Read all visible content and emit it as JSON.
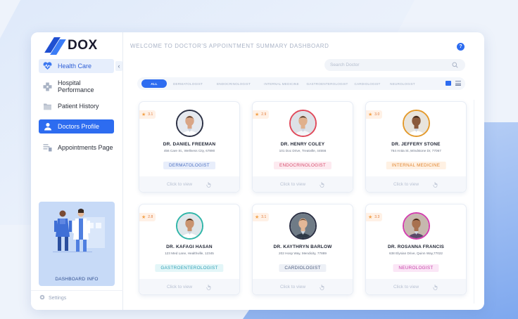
{
  "app": {
    "logo": "DOX"
  },
  "sidebar": {
    "items": [
      {
        "label": "Health Care",
        "icon": "heart-pulse-icon"
      },
      {
        "label": "Hospital Performance",
        "icon": "hospital-icon"
      },
      {
        "label": "Patient History",
        "icon": "folder-icon"
      },
      {
        "label": "Doctors Profile",
        "icon": "user-icon"
      },
      {
        "label": "Appointments Page",
        "icon": "calendar-list-icon"
      }
    ],
    "promo_label": "DASHBOARD INFO",
    "settings_label": "Settings"
  },
  "header": {
    "title": "WELCOME TO DOCTOR'S APPOINTMENT SUMMARY DASHBOARD",
    "help": "?"
  },
  "search": {
    "placeholder": "Search Doctor"
  },
  "filters": [
    "ALL",
    "DERMATOLOGIST",
    "ENDOCRINOLOGIST",
    "INTERNAL MEDICINE",
    "GASTROENTEROLOGIST",
    "CARDIOLOGIST",
    "NEUROLOGIST"
  ],
  "card_action": "Click to view",
  "doctors": [
    {
      "name": "DR. DANIEL FREEMAN",
      "address": "456 Care St., Wellness City, 67890",
      "specialty": "DERMATOLOGIST",
      "rating": "3.1",
      "ring": "#2b3044",
      "skin": "#d9a585",
      "hair": "#3a2d25",
      "bg": "#e5e9ef",
      "coat": "#ffffff",
      "tagText": "#4b6fc2",
      "tagBg": "#e8eefb"
    },
    {
      "name": "DR. HENRY COLEY",
      "address": "101 Doc Drive, Treatville, 44556",
      "specialty": "ENDOCRINOLOGIST",
      "rating": "2.9",
      "ring": "#e0495a",
      "skin": "#e0b08c",
      "hair": "#2f2520",
      "bg": "#dde1e7",
      "coat": "#f4f6f9",
      "tagText": "#d64b6b",
      "tagBg": "#fdeaf0"
    },
    {
      "name": "DR. JEFFERY STONE",
      "address": "764 Anita St.,Windstone Dr, 77067",
      "specialty": "INTERNAL MEDICINE",
      "rating": "3.0",
      "ring": "#e39a2c",
      "skin": "#8a5a3c",
      "hair": "#1f1612",
      "bg": "#e8e4dc",
      "coat": "#ffffff",
      "tagText": "#e0852f",
      "tagBg": "#fff1e3"
    },
    {
      "name": "DR. KAFAGI HASAN",
      "address": "123 Med Lane, Healthville, 12345",
      "specialty": "GASTROENTEROLOGIST",
      "rating": "2.8",
      "ring": "#2fb5a8",
      "skin": "#c99470",
      "hair": "#1d1714",
      "bg": "#dfe6ea",
      "coat": "#ffffff",
      "tagText": "#2d9fb4",
      "tagBg": "#e3f6f8"
    },
    {
      "name": "DR. KAYTHRYN BARLOW",
      "address": "202 Hosp Way, Mendicity, 77889",
      "specialty": "CARDIOLOGIST",
      "rating": "3.1",
      "ring": "#2b3044",
      "skin": "#e3b797",
      "hair": "#6a4a33",
      "bg": "#6f7b86",
      "coat": "#2f3a48",
      "tagText": "#4b5a7c",
      "tagBg": "#edf0f6"
    },
    {
      "name": "DR. ROSANNA FRANCIS",
      "address": "638 Elysian Drive, Quinn Way,77022",
      "specialty": "NEUROLOGIST",
      "rating": "3.3",
      "ring": "#d23fae",
      "skin": "#a8714f",
      "hair": "#24170f",
      "bg": "#c6b8ae",
      "coat": "#5a4a6a",
      "tagText": "#c43ea6",
      "tagBg": "#fbe6f6"
    }
  ]
}
